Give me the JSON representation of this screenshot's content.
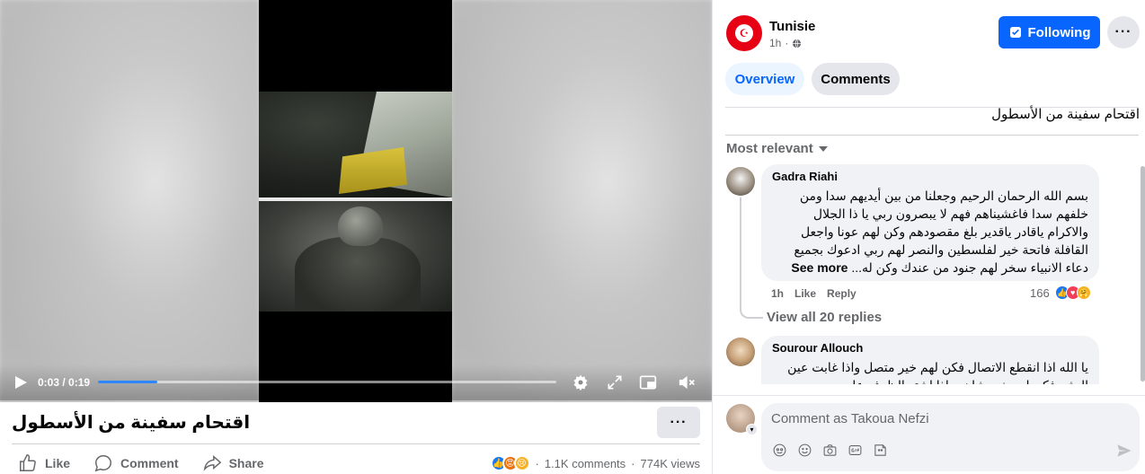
{
  "video": {
    "time": "0:03 / 0:19",
    "progress_fraction": 0.13,
    "title": "اقتحام سفينة من الأسطول",
    "icons": [
      "play-icon",
      "settings-icon",
      "fullscreen-icon",
      "miniplayer-icon",
      "mute-icon"
    ]
  },
  "post_actions": {
    "like": "Like",
    "comment": "Comment",
    "share": "Share",
    "comments_count": "1.1K comments",
    "views": "774K views",
    "separator": "·"
  },
  "page": {
    "name": "Tunisie",
    "time": "1h",
    "follow_label": "Following",
    "brand_color": "#0866ff",
    "flag_color": "#e70013"
  },
  "tabs": {
    "overview": "Overview",
    "comments": "Comments"
  },
  "caption": "اقتحام سفينة من الأسطول",
  "sort_label": "Most relevant",
  "comments": [
    {
      "author": "Gadra Riahi",
      "text": "بسم الله الرحمان الرحيم وجعلنا من بين أيديهم سدا ومن خلفهم سدا فاغشيناهم فهم لا يبصرون ربي يا ذا الجلال والاكرام ياقادر ياقدير بلغ مقصودهم وكن لهم عونا واجعل القافلة فاتحة خير لفلسطين والنصر لهم ربي ادعوك بجميع دعاء الانبياء سخر لهم جنود من عندك وكن له...",
      "see_more": "See more",
      "time": "1h",
      "like": "Like",
      "reply": "Reply",
      "reactions": "166",
      "view_replies": "View all 20 replies"
    },
    {
      "author": "Sourour Allouch",
      "text": "يا الله اذا انقطع الاتصال فكن لهم خير متصل واذا غابت عين البشر فكن لهم خير شاهد واذا اشتد الظرف عليهم",
      "see_more": "",
      "time": "",
      "like": "",
      "reply": "",
      "reactions": "",
      "view_replies": ""
    }
  ],
  "composer": {
    "placeholder": "Comment as Takoua Nefzi",
    "icons": [
      "avatar-sticker-icon",
      "emoji-icon",
      "camera-icon",
      "gif-icon",
      "sticker-icon",
      "send-icon"
    ]
  }
}
